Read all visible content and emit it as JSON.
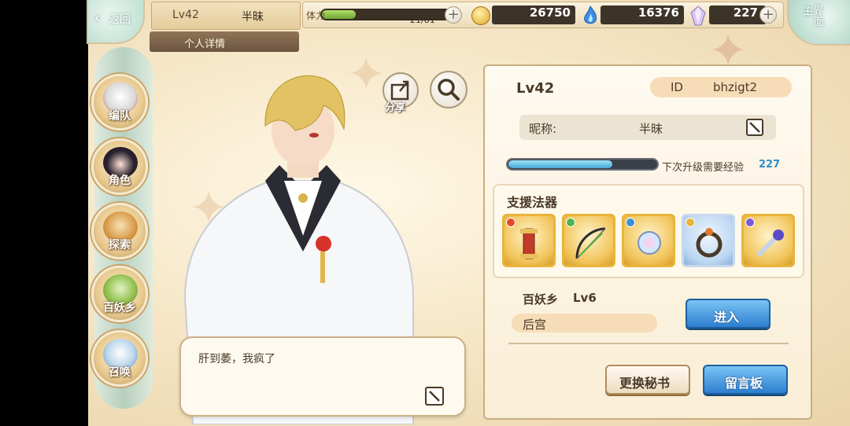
{
  "header": {
    "back_label": "返回",
    "home_label_1": "主界",
    "home_label_2": "面",
    "player_level": "Lv42",
    "player_name": "半昧",
    "detail_tab": "个人详情"
  },
  "resources": {
    "stamina_label": "体力",
    "stamina_text": "21/81",
    "stamina_fraction": 0.26,
    "gold": "26750",
    "soul_fire": "16376",
    "crystal": "227"
  },
  "sidebar": {
    "items": [
      {
        "label": "编队",
        "icon": "team-icon"
      },
      {
        "label": "角色",
        "icon": "character-icon"
      },
      {
        "label": "探索",
        "icon": "explore-icon"
      },
      {
        "label": "百妖乡",
        "icon": "village-icon"
      },
      {
        "label": "召唤",
        "icon": "summon-icon"
      }
    ]
  },
  "actions": {
    "share_label": "分享"
  },
  "bubble": {
    "text": "肝到萎，我疯了"
  },
  "profile": {
    "level": "Lv42",
    "id_key": "ID",
    "id_value": "bhzigt2",
    "nick_key": "昵称:",
    "nick_value": "半昧",
    "exp_label": "下次升级需要经验",
    "exp_value": "227",
    "exp_fraction": 0.7,
    "relic_title": "支援法器",
    "relics": [
      {
        "name": "scroll-relic",
        "gem_color": "#e24a2a",
        "style": "gold"
      },
      {
        "name": "bow-relic",
        "gem_color": "#4fb34a",
        "style": "gold"
      },
      {
        "name": "mirror-relic",
        "gem_color": "#3a8fd6",
        "style": "gold"
      },
      {
        "name": "ring-relic",
        "gem_color": "#e8b53a",
        "style": "blue"
      },
      {
        "name": "sword-relic",
        "gem_color": "#7a5ad6",
        "style": "gold"
      }
    ],
    "town_label": "百妖乡",
    "town_level": "Lv6",
    "harem_label": "后宫",
    "enter_label": "进入",
    "secretary_label": "更换秘书",
    "message_label": "留言板"
  }
}
